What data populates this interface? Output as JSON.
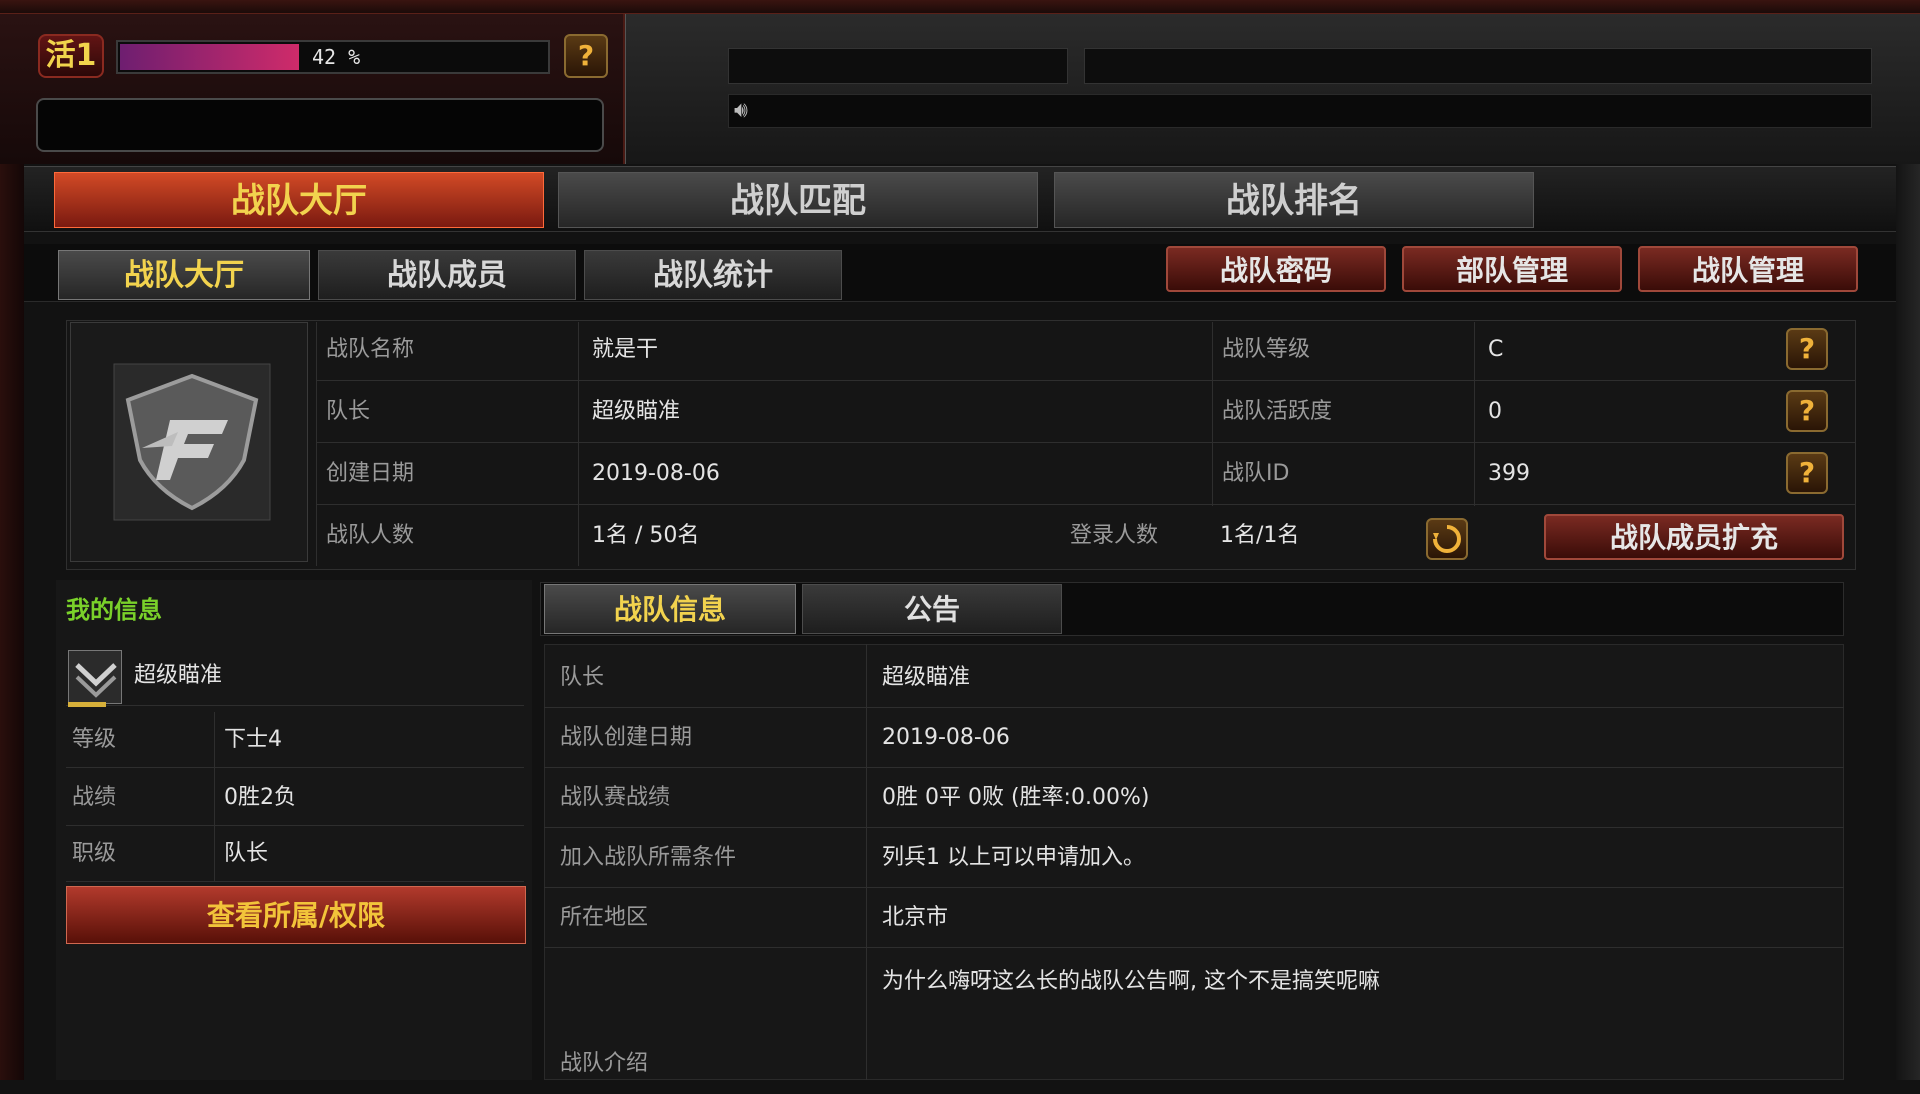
{
  "activity": {
    "badge": "活1",
    "progress_text": "42 %",
    "progress": 0.42,
    "help": "?"
  },
  "main_tabs": [
    "战队大厅",
    "战队匹配",
    "战队排名"
  ],
  "sub_tabs": [
    "战队大厅",
    "战队成员",
    "战队统计"
  ],
  "actions": [
    "战队密码",
    "部队管理",
    "战队管理"
  ],
  "clan": {
    "labels": {
      "name": "战队名称",
      "leader": "队长",
      "created": "创建日期",
      "members": "战队人数",
      "level": "战队等级",
      "activity": "战队活跃度",
      "id": "战队ID",
      "online": "登录人数"
    },
    "values": {
      "name": "就是干",
      "leader": "超级瞄准",
      "created": "2019-08-06",
      "members": "1名 / 50名",
      "level": "C",
      "activity": "0",
      "id": "399",
      "online": "1名/1名"
    },
    "help": "?",
    "expand_button": "战队成员扩充"
  },
  "my_info": {
    "title": "我的信息",
    "name": "超级瞄准",
    "rows": [
      {
        "label": "等级",
        "value": "下士4"
      },
      {
        "label": "战绩",
        "value": "0胜2负"
      },
      {
        "label": "职级",
        "value": "队长"
      }
    ],
    "view_button": "查看所属/权限"
  },
  "details": {
    "tabs": [
      "战队信息",
      "公告"
    ],
    "rows": [
      {
        "label": "队长",
        "value": "超级瞄准"
      },
      {
        "label": "战队创建日期",
        "value": "2019-08-06"
      },
      {
        "label": "战队赛战绩",
        "value": "0胜  0平  0败  (胜率:0.00%)"
      },
      {
        "label": "加入战队所需条件",
        "value": "列兵1 以上可以申请加入。"
      },
      {
        "label": "所在地区",
        "value": "北京市"
      }
    ],
    "intro_label": "战队介绍",
    "intro_value": "为什么嗨呀这么长的战队公告啊, 这个不是搞笑呢嘛"
  },
  "colors": {
    "accent_red": "#d24a26",
    "gold": "#f2d34e",
    "green": "#7ad12a"
  },
  "icons": {
    "speaker": "speaker-icon",
    "refresh": "refresh-icon",
    "emblem": "cf-emblem-icon"
  }
}
